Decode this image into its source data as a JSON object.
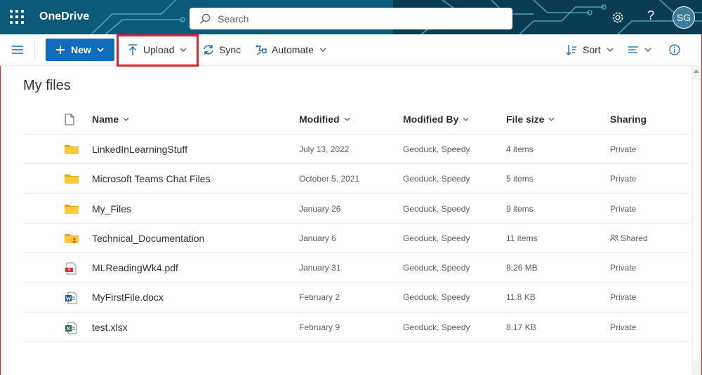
{
  "app": {
    "name": "OneDrive"
  },
  "search": {
    "placeholder": "Search"
  },
  "user": {
    "initials": "SG"
  },
  "help_label": "?",
  "toolbar": {
    "new_label": "New",
    "upload_label": "Upload",
    "sync_label": "Sync",
    "automate_label": "Automate",
    "sort_label": "Sort"
  },
  "page": {
    "title": "My files"
  },
  "columns": {
    "name": "Name",
    "modified": "Modified",
    "modified_by": "Modified By",
    "file_size": "File size",
    "sharing": "Sharing"
  },
  "files": [
    {
      "icon": "folder-icon",
      "name": "LinkedInLearningStuff",
      "modified": "July 13, 2022",
      "modified_by": "Geoduck, Speedy",
      "size": "4 items",
      "sharing": "Private"
    },
    {
      "icon": "folder-icon",
      "name": "Microsoft Teams Chat Files",
      "modified": "October 5, 2021",
      "modified_by": "Geoduck, Speedy",
      "size": "5 items",
      "sharing": "Private"
    },
    {
      "icon": "folder-icon",
      "name": "My_Files",
      "modified": "January 26",
      "modified_by": "Geoduck, Speedy",
      "size": "9 items",
      "sharing": "Private"
    },
    {
      "icon": "shared-folder-icon",
      "name": "Technical_Documentation",
      "modified": "January 6",
      "modified_by": "Geoduck, Speedy",
      "size": "11 items",
      "sharing": "Shared"
    },
    {
      "icon": "pdf-file-icon",
      "name": "MLReadingWk4.pdf",
      "modified": "January 31",
      "modified_by": "Geoduck, Speedy",
      "size": "8.26 MB",
      "sharing": "Private"
    },
    {
      "icon": "word-file-icon",
      "name": "MyFirstFile.docx",
      "modified": "February 2",
      "modified_by": "Geoduck, Speedy",
      "size": "11.8 KB",
      "sharing": "Private"
    },
    {
      "icon": "excel-file-icon",
      "name": "test.xlsx",
      "modified": "February 9",
      "modified_by": "Geoduck, Speedy",
      "size": "8.17 KB",
      "sharing": "Private"
    }
  ],
  "colors": {
    "suitebar": "#0b5a7a",
    "accent": "#0f6cbd",
    "highlight": "#e0202b",
    "folder": "#ffc83d"
  }
}
